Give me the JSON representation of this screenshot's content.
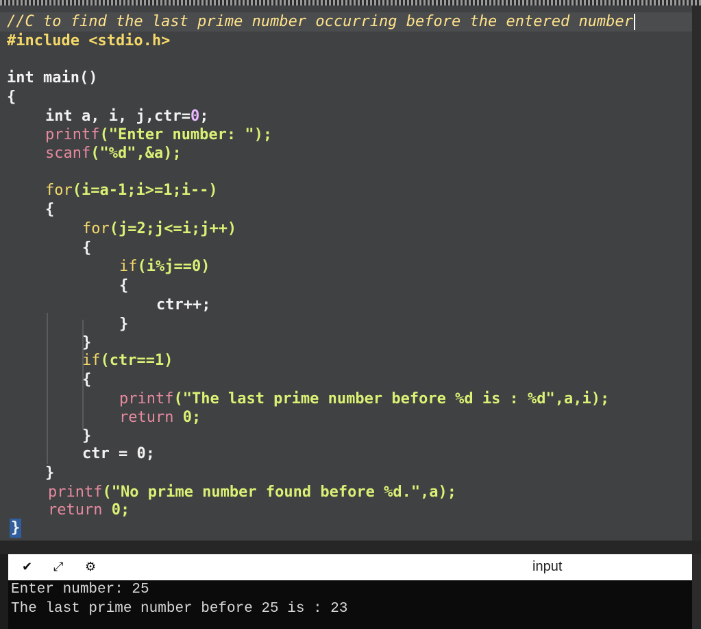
{
  "editor": {
    "lines": {
      "l1": "//C to find the last prime number occurring before the entered number",
      "l2": "#include <stdio.h>",
      "l3": "",
      "l4_kw": "int",
      "l4_rest": " main()",
      "l5": "{",
      "l6_kw": "int",
      "l6_rest": " a, i, j,ctr=",
      "l6_num": "0",
      "l6_end": ";",
      "l7_fn": "printf",
      "l7_str": "(\"Enter number: \");",
      "l8_fn": "scanf",
      "l8_str": "(\"%d\",&a);",
      "l9": "",
      "l10_kw": "for",
      "l10_rest": "(i=a-1;i>=1;i--)",
      "l11": "{",
      "l12_kw": "for",
      "l12_rest": "(j=2;j<=i;j++)",
      "l13": "{",
      "l14_kw": "if",
      "l14_rest": "(i%j==0)",
      "l15": "{",
      "l16": "ctr++;",
      "l17": "}",
      "l18": "}",
      "l19_kw": "if",
      "l19_rest": "(ctr==1)",
      "l20": "{",
      "l21_fn": "printf",
      "l21_str": "(\"The last prime number before %d is : %d\",a,i);",
      "l22_kw": "return",
      "l22_rest": " 0;",
      "l23": "}",
      "l24": "ctr = 0;",
      "l25": "}",
      "l26_fn": "printf",
      "l26_str": "(\"No prime number found before %d.\",a);",
      "l27_kw": "return",
      "l27_rest": " 0;",
      "l28": "}"
    }
  },
  "toolbar": {
    "input_label": "input",
    "icons": [
      "chevron-down-icon",
      "expand-icon",
      "settings-icon"
    ]
  },
  "console": {
    "line1": "Enter number: 25",
    "line2": "The last prime number before 25 is : 23"
  },
  "colors": {
    "editor_bg": "#404142",
    "comment": "#ffe38a",
    "keyword": "#e58aa0",
    "control": "#f4d86a",
    "string": "#d9f275",
    "console_bg": "#0b0b0b"
  }
}
